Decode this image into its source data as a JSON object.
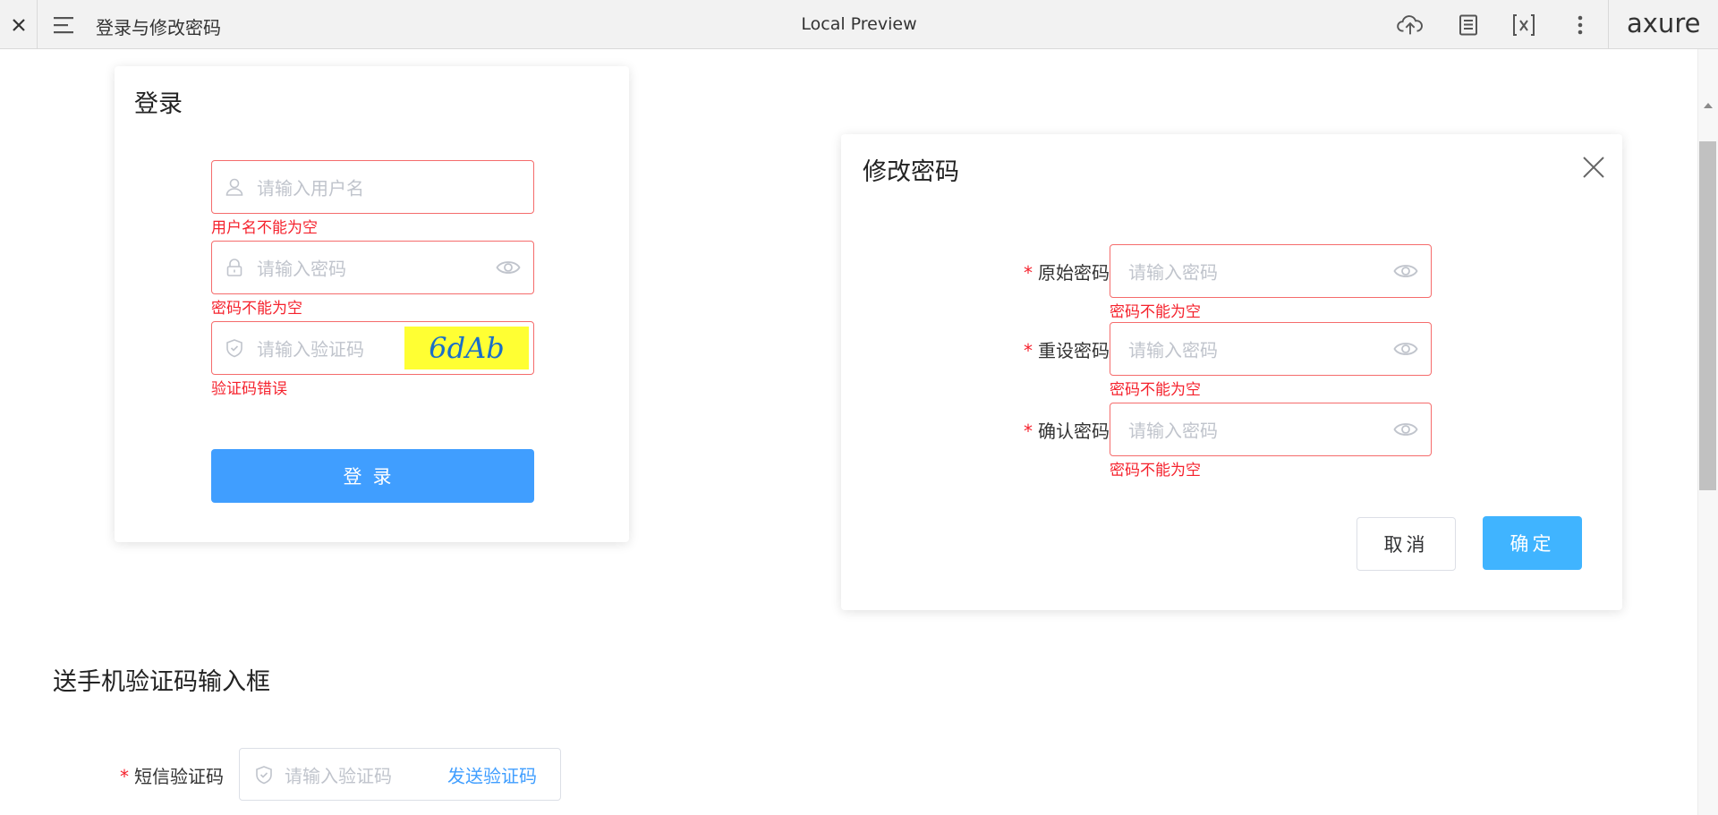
{
  "toolbar": {
    "title": "登录与修改密码",
    "center_label": "Local Preview",
    "logo": "axure",
    "icons": [
      "close-icon",
      "menu-icon",
      "cloud-upload-icon",
      "document-icon",
      "variable-icon",
      "more-icon"
    ]
  },
  "login": {
    "title": "登录",
    "username_placeholder": "请输入用户名",
    "username_error": "用户名不能为空",
    "password_placeholder": "请输入密码",
    "password_error": "密码不能为空",
    "captcha_placeholder": "请输入验证码",
    "captcha_text": "6dAb",
    "captcha_error": "验证码错误",
    "submit_label": "登录"
  },
  "change_password": {
    "title": "修改密码",
    "fields": [
      {
        "label": "原始密码",
        "placeholder": "请输入密码",
        "error": "密码不能为空"
      },
      {
        "label": "重设密码",
        "placeholder": "请输入密码",
        "error": "密码不能为空"
      },
      {
        "label": "确认密码",
        "placeholder": "请输入密码",
        "error": "密码不能为空"
      }
    ],
    "required_mark": "*",
    "cancel_label": "取消",
    "ok_label": "确定"
  },
  "sms": {
    "section_title": "送手机验证码输入框",
    "required_mark": "*",
    "label": "短信验证码",
    "placeholder": "请输入验证码",
    "send_label": "发送验证码"
  },
  "colors": {
    "primary": "#409eff",
    "confirm": "#40b4ff",
    "error": "#f5222d",
    "error_border": "#f56c6c",
    "captcha_bg": "#ffff33"
  }
}
